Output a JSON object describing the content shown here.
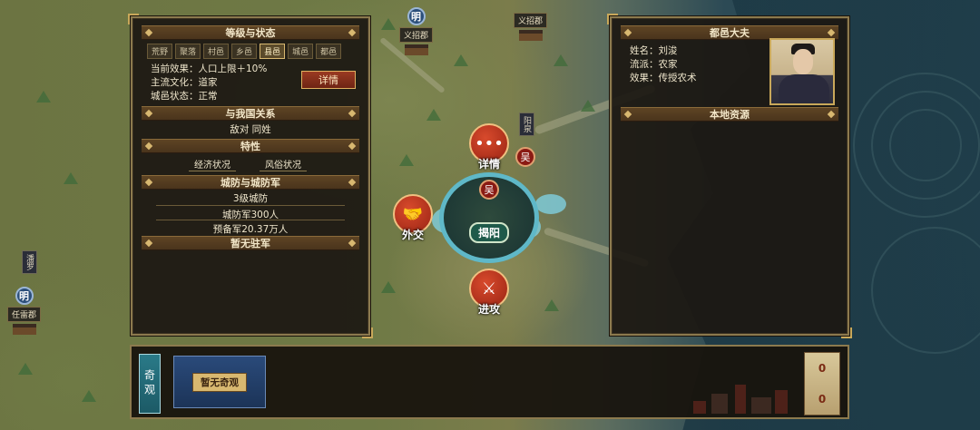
{
  "map": {
    "markers": [
      {
        "badge": "明",
        "label": "义招郡"
      },
      {
        "badge": "明",
        "label": "义招郡"
      },
      {
        "badge": "明",
        "label": "任雷郡"
      }
    ],
    "banners": [
      "阳泉",
      "潘罗",
      "义招郡"
    ]
  },
  "left_panel": {
    "header_rank": "等级与状态",
    "tiers": [
      "荒野",
      "聚落",
      "村邑",
      "乡邑",
      "县邑",
      "城邑",
      "都邑"
    ],
    "active_tier_index": 4,
    "effect_label": "当前效果：",
    "effect_value": "人口上限＋10%",
    "culture_label": "主流文化：",
    "culture_value": "道家",
    "status_label": "城邑状态：",
    "status_value": "正常",
    "detail_button": "详情",
    "header_relation": "与我国关系",
    "relation_value": "敌对  同姓",
    "header_traits": "特性",
    "trait_economy": "经济状况",
    "trait_custom": "风俗状况",
    "header_defense": "城防与城防军",
    "defense_level": "3级城防",
    "garrison": "城防军300人",
    "reserve": "预备军20.37万人",
    "header_station": "暂无驻军"
  },
  "right_panel": {
    "header": "都邑大夫",
    "name_label": "姓名：",
    "name_value": "刘浚",
    "school_label": "流派：",
    "school_value": "农家",
    "effect_label": "效果：",
    "effect_value": "传授农术",
    "resources_header": "本地资源"
  },
  "actions": {
    "detail": {
      "icon": "•••",
      "label": "详情"
    },
    "diplomacy": {
      "icon": "🤝",
      "label": "外交"
    },
    "attack": {
      "icon": "⚔",
      "label": "进攻"
    },
    "city_name": "揭阳",
    "faction_badge": "吴",
    "faction_badge_top": "吴"
  },
  "bottom": {
    "tab_label": "奇观",
    "card_label": "暂无奇观",
    "counter_top": "0",
    "counter_bottom": "0"
  }
}
